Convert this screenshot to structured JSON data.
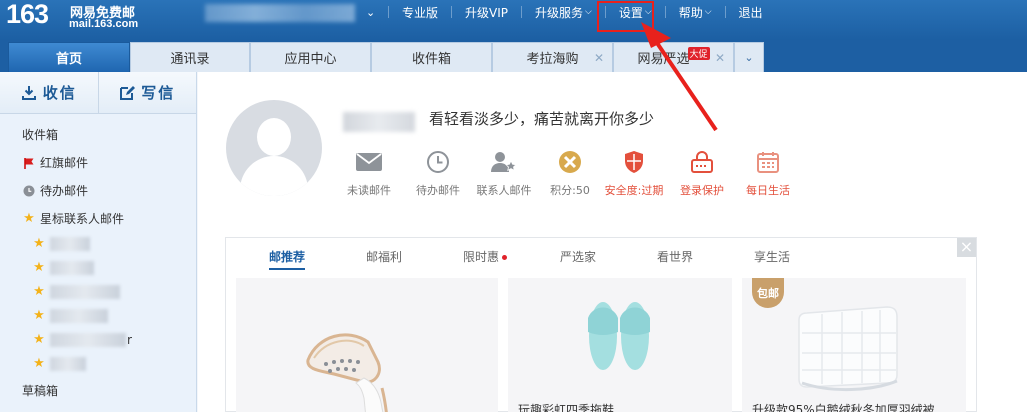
{
  "header": {
    "logo_number": "163",
    "logo_brand": "网易免费邮",
    "logo_domain": "mail.163.com",
    "nav": [
      {
        "label": "专业版"
      },
      {
        "label": "升级VIP"
      },
      {
        "label": "升级服务"
      },
      {
        "label": "设置"
      },
      {
        "label": "帮助"
      },
      {
        "label": "退出"
      }
    ]
  },
  "tabs": [
    {
      "label": "首页",
      "active": true
    },
    {
      "label": "通讯录"
    },
    {
      "label": "应用中心"
    },
    {
      "label": "收件箱"
    },
    {
      "label": "考拉海购"
    },
    {
      "label": "网易严选",
      "badge": "大促"
    }
  ],
  "sidebar": {
    "receive_label": "收信",
    "compose_label": "写信",
    "folders": [
      {
        "label": "收件箱"
      },
      {
        "label": "红旗邮件"
      },
      {
        "label": "待办邮件"
      },
      {
        "label": "星标联系人邮件"
      }
    ],
    "contact_suffix": "r",
    "drafts_label": "草稿箱"
  },
  "profile": {
    "motto": "看轻看淡多少，痛苦就离开你多少"
  },
  "quick_links": [
    {
      "label": "未读邮件",
      "icon": "envelope-icon"
    },
    {
      "label": "待办邮件",
      "icon": "clock-icon"
    },
    {
      "label": "联系人邮件",
      "icon": "contact-star-icon"
    },
    {
      "label": "积分:50",
      "icon": "coin-icon"
    },
    {
      "label": "安全度:过期",
      "icon": "shield-icon"
    },
    {
      "label": "登录保护",
      "icon": "lock-icon"
    },
    {
      "label": "每日生活",
      "icon": "calendar-icon"
    }
  ],
  "promo": {
    "tabs": [
      {
        "label": "邮推荐"
      },
      {
        "label": "邮福利"
      },
      {
        "label": "限时惠"
      },
      {
        "label": "严选家"
      },
      {
        "label": "看世界"
      },
      {
        "label": "享生活"
      }
    ],
    "cards": [
      {
        "title": ""
      },
      {
        "title": "玩趣彩虹四季拖鞋"
      },
      {
        "title": "升级款95%白鹅绒秋冬加厚羽绒被",
        "badge": "包邮"
      }
    ]
  },
  "colors": {
    "brand_blue": "#1d5fa3",
    "highlight_red": "#e8211c",
    "star_yellow": "#f3b21a",
    "alert_red": "#e3503c"
  }
}
